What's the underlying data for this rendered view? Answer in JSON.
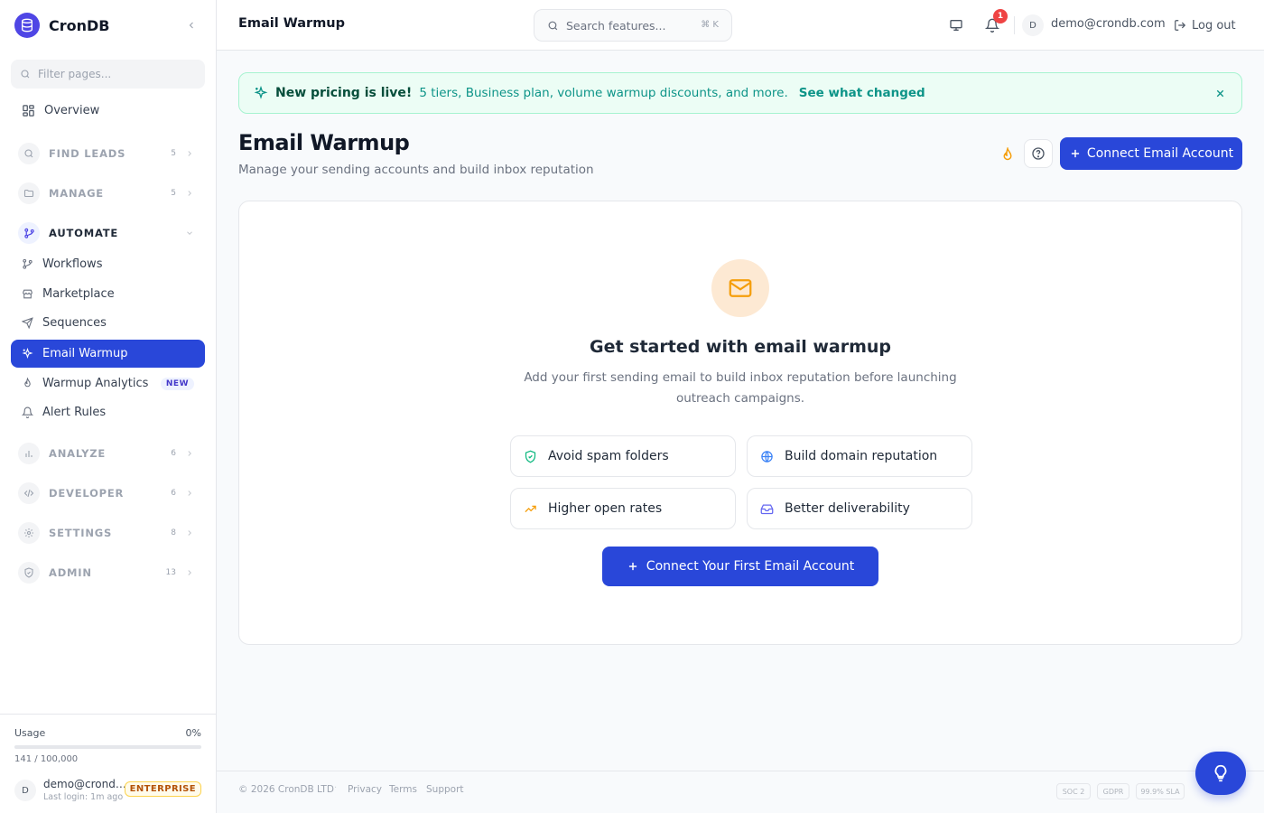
{
  "brand": {
    "name": "CronDB"
  },
  "sidebar": {
    "filter_placeholder": "Filter pages...",
    "overview": "Overview",
    "sections": [
      {
        "label": "FIND LEADS",
        "count": "5"
      },
      {
        "label": "MANAGE",
        "count": "5"
      },
      {
        "label": "AUTOMATE"
      },
      {
        "label": "ANALYZE",
        "count": "6"
      },
      {
        "label": "DEVELOPER",
        "count": "6"
      },
      {
        "label": "SETTINGS",
        "count": "8"
      },
      {
        "label": "ADMIN",
        "count": "13"
      }
    ],
    "automate_items": [
      {
        "label": "Workflows"
      },
      {
        "label": "Marketplace"
      },
      {
        "label": "Sequences"
      },
      {
        "label": "Email Warmup",
        "active": true
      },
      {
        "label": "Warmup Analytics",
        "badge": "NEW"
      },
      {
        "label": "Alert Rules"
      }
    ],
    "usage": {
      "title": "Usage",
      "percent": "0%",
      "fraction": 0,
      "count": "141 / 100,000"
    },
    "user": {
      "initial": "D",
      "email": "demo@crondb.com",
      "last_login": "Last login: 1m ago",
      "plan": "ENTERPRISE"
    }
  },
  "topbar": {
    "title": "Email Warmup",
    "search_placeholder": "Search features...",
    "search_shortcut": "⌘ K",
    "notification_count": "1",
    "avatar_initial": "D",
    "email": "demo@crondb.com",
    "logout": "Log out"
  },
  "banner": {
    "title": "New pricing is live!",
    "text": "5 tiers, Business plan, volume warmup discounts, and more.",
    "link": "See what changed"
  },
  "page": {
    "title": "Email Warmup",
    "subtitle": "Manage your sending accounts and build inbox reputation",
    "connect_button": "Connect Email Account"
  },
  "empty_state": {
    "title": "Get started with email warmup",
    "description": "Add your first sending email to build inbox reputation before launching outreach campaigns.",
    "features": [
      {
        "label": "Avoid spam folders",
        "icon": "shield-check-icon"
      },
      {
        "label": "Build domain reputation",
        "icon": "globe-icon"
      },
      {
        "label": "Higher open rates",
        "icon": "trending-up-icon"
      },
      {
        "label": "Better deliverability",
        "icon": "inbox-icon"
      }
    ],
    "cta": "Connect Your First Email Account"
  },
  "footer": {
    "copyright": "© 2026 CronDB LTD",
    "separator": "·",
    "links": [
      "Privacy",
      "Terms",
      "Support"
    ],
    "badges": [
      "SOC 2",
      "GDPR",
      "99.9% SLA"
    ]
  },
  "colors": {
    "accent": "#2947d9",
    "banner_bg": "#ecfdf5",
    "banner_text": "#0d9488",
    "warmup_icon": "#f59e0b",
    "notification": "#ef4444",
    "plan_badge": "#b45309"
  }
}
